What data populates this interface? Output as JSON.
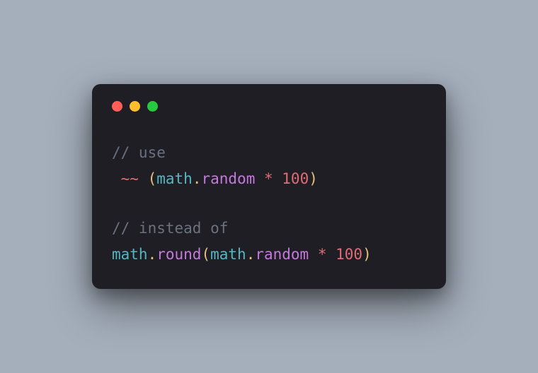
{
  "window": {
    "traffic_lights": {
      "red": "#ff5f56",
      "yellow": "#ffbd2e",
      "green": "#27c93f"
    }
  },
  "code": {
    "line1_comment": "// use",
    "line2": {
      "indent": " ",
      "tilde": "~~",
      "open": " (",
      "obj1": "math",
      "dot1": ".",
      "method1": "random",
      "star": " * ",
      "num": "100",
      "close": ")"
    },
    "line4_comment": "// instead of",
    "line5": {
      "obj1": "math",
      "dot1": ".",
      "method1": "round",
      "open": "(",
      "obj2": "math",
      "dot2": ".",
      "method2": "random",
      "star": " * ",
      "num": "100",
      "close": ")"
    }
  }
}
